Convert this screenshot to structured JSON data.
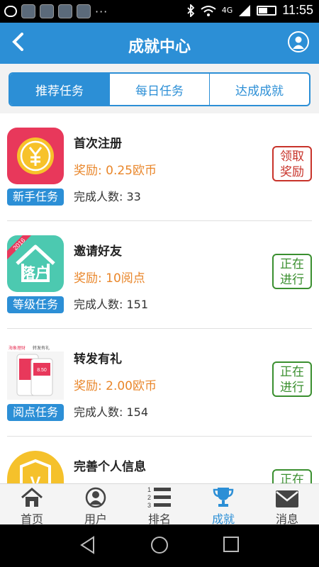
{
  "status_bar": {
    "time": "11:55",
    "network": "4G",
    "dots": "···"
  },
  "header": {
    "title": "成就中心",
    "back_glyph": "‹"
  },
  "tabs": [
    {
      "label": "推荐任务",
      "active": true
    },
    {
      "label": "每日任务",
      "active": false
    },
    {
      "label": "达成成就",
      "active": false
    }
  ],
  "tasks": [
    {
      "name": "首次注册",
      "reward": "奖励: 0.25欧币",
      "completions": "完成人数: 33",
      "badge": "新手任务",
      "action_line1": "领取",
      "action_line2": "奖励",
      "action_style": "red",
      "icon": "coin-icon"
    },
    {
      "name": "邀请好友",
      "reward": "奖励: 10阅点",
      "completions": "完成人数: 151",
      "badge": "等级任务",
      "action_line1": "正在",
      "action_line2": "进行",
      "action_style": "green",
      "icon": "house-icon",
      "icon_text": "落户",
      "icon_ribbon": "2016"
    },
    {
      "name": "转发有礼",
      "reward": "奖励: 2.00欧币",
      "completions": "完成人数: 154",
      "badge": "阅点任务",
      "action_line1": "正在",
      "action_line2": "进行",
      "action_style": "green",
      "icon": "share-banner-icon",
      "icon_text_a": "海象理财",
      "icon_text_b": "转发有礼",
      "icon_amount": "8.50"
    },
    {
      "name": "完善个人信息",
      "reward": "",
      "completions": "",
      "badge": "",
      "action_line1": "正在",
      "action_line2": "",
      "action_style": "green",
      "icon": "shield-icon",
      "icon_text": "V"
    }
  ],
  "bottom_nav": [
    {
      "label": "首页",
      "icon": "home-icon",
      "active": false
    },
    {
      "label": "用户",
      "icon": "user-icon",
      "active": false
    },
    {
      "label": "排名",
      "icon": "ranking-icon",
      "active": false
    },
    {
      "label": "成就",
      "icon": "trophy-icon",
      "active": true
    },
    {
      "label": "消息",
      "icon": "mail-icon",
      "active": false
    }
  ],
  "colors": {
    "primary": "#2c8fd6",
    "reward": "#e9862a",
    "claim": "#c8332a",
    "progress": "#3a8f2f"
  }
}
